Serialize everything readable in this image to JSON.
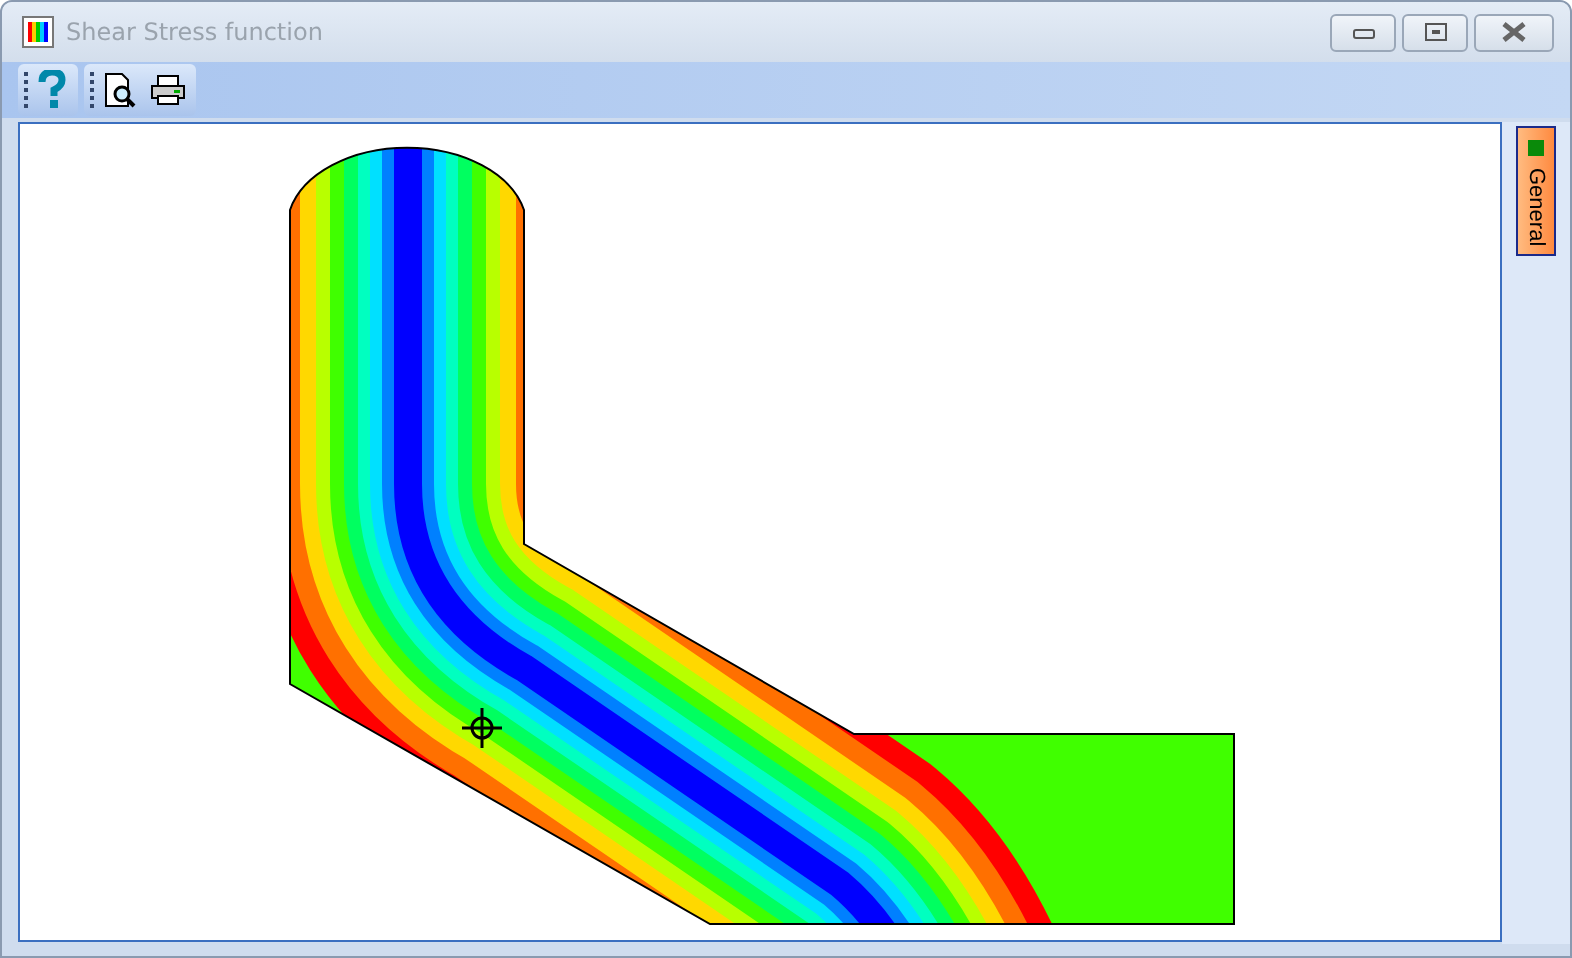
{
  "window": {
    "title": "Shear Stress function"
  },
  "side_tabs": [
    {
      "label": "General"
    }
  ]
}
